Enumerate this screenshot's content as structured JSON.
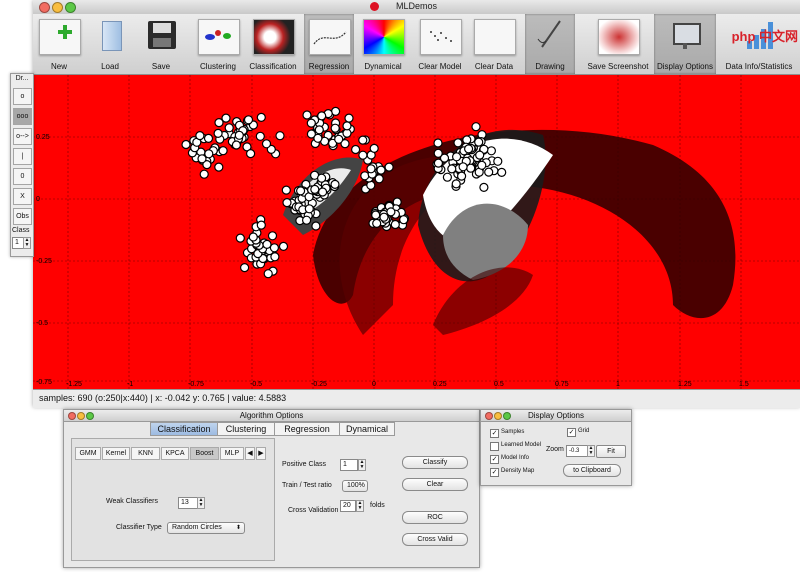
{
  "window": {
    "title": "MLDemos"
  },
  "toolbar": {
    "buttons": [
      {
        "label": "New",
        "icon": "new-document-icon"
      },
      {
        "label": "Load",
        "icon": "load-folder-icon"
      },
      {
        "label": "Save",
        "icon": "save-disk-icon"
      },
      {
        "label": "Clustering",
        "icon": "clustering-icon"
      },
      {
        "label": "Classification",
        "icon": "classification-icon"
      },
      {
        "label": "Regression",
        "icon": "regression-icon"
      },
      {
        "label": "Dynamical",
        "icon": "dynamical-icon"
      },
      {
        "label": "Clear Model",
        "icon": "clear-model-icon"
      },
      {
        "label": "Clear Data",
        "icon": "clear-data-icon"
      },
      {
        "label": "Drawing",
        "icon": "drawing-icon"
      },
      {
        "label": "Save Screenshot",
        "icon": "screenshot-icon"
      },
      {
        "label": "Display Options",
        "icon": "display-options-icon"
      },
      {
        "label": "Data Info/Statistics",
        "icon": "statistics-icon"
      }
    ]
  },
  "draw_panel": {
    "title": "Dr...",
    "buttons": [
      "o",
      "ooo",
      "o-->",
      "|",
      "0",
      "X",
      "Obs"
    ],
    "class_label": "Class",
    "class_value": "1"
  },
  "plot": {
    "y_ticks": [
      "0.25",
      "0",
      "-0.25",
      "-0.5",
      "-0.75"
    ],
    "x_ticks": [
      "-1.25",
      "-1",
      "-0.75",
      "-0.5",
      "-0.25",
      "0",
      "0.25",
      "0.5",
      "0.75",
      "1",
      "1.25",
      "1.5"
    ],
    "background_color": "#ff0000"
  },
  "status": {
    "text": "samples: 690 (o:250|x:440) | x: -0.042 y: 0.765 | value: 4.5883"
  },
  "algorithm_options": {
    "title": "Algorithm Options",
    "tabs": [
      "Classification",
      "Clustering",
      "Regression",
      "Dynamical"
    ],
    "active_tab": "Classification",
    "subtabs": [
      "GMM",
      "Kernel",
      "KNN",
      "KPCA",
      "Boost",
      "MLP"
    ],
    "active_subtab": "Boost",
    "weak_classifiers_label": "Weak Classifiers",
    "weak_classifiers_value": "13",
    "classifier_type_label": "Classifier Type",
    "classifier_type_value": "Random Circles",
    "positive_class_label": "Positive Class",
    "positive_class_value": "1",
    "train_test_label": "Train / Test ratio",
    "train_test_value": "100%",
    "cross_validation_label": "Cross Validation",
    "cross_validation_value": "20",
    "folds_label": "folds",
    "buttons": {
      "classify": "Classify",
      "clear": "Clear",
      "roc": "ROC",
      "cross_valid": "Cross Valid"
    }
  },
  "display_options": {
    "title": "Display Options",
    "samples": {
      "label": "Samples",
      "checked": true
    },
    "grid": {
      "label": "Grid",
      "checked": true
    },
    "learned_model": {
      "label": "Learned Model",
      "checked": false
    },
    "model_info": {
      "label": "Model Info",
      "checked": true
    },
    "density_map": {
      "label": "Density Map",
      "checked": true
    },
    "zoom_label": "Zoom",
    "zoom_value": "-0.3",
    "fit_label": "Fit",
    "clipboard_label": "to Clipboard"
  },
  "watermark": {
    "text": "php 中文网"
  }
}
